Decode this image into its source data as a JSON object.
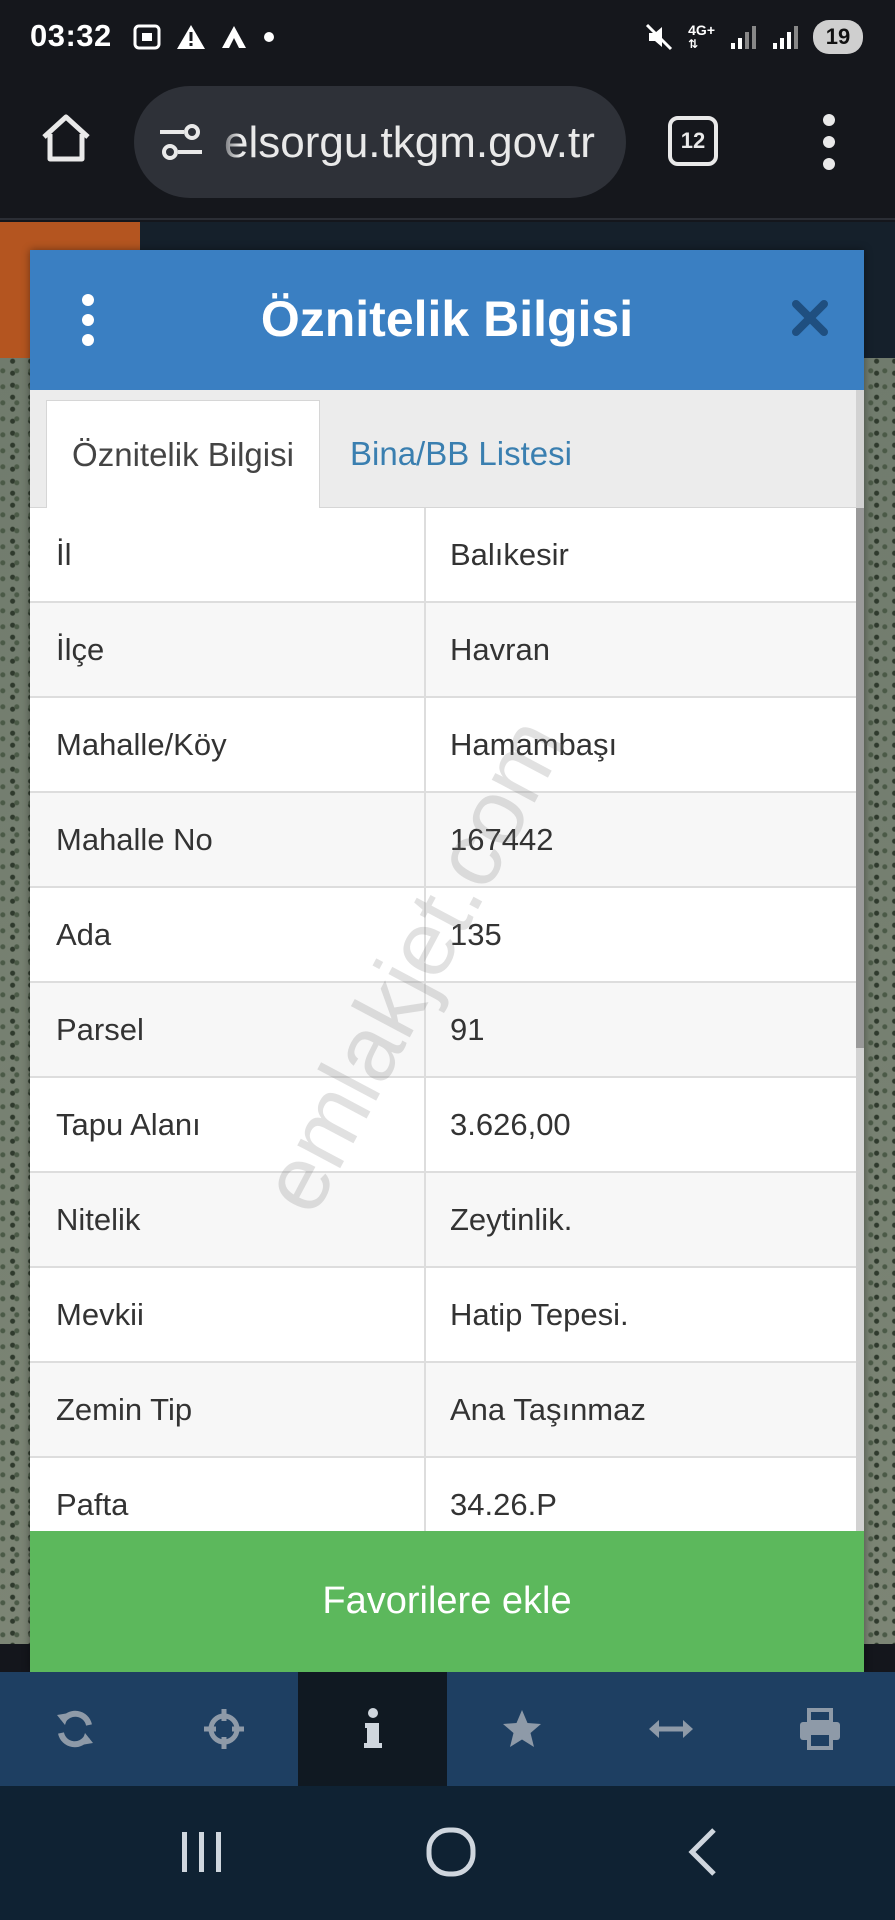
{
  "status_bar": {
    "time": "03:32",
    "left_icons": [
      "screenshot-icon",
      "warning-icon",
      "app-a-icon",
      "dot-icon"
    ],
    "right_icons": [
      "mute-icon",
      "4g-signal-icon",
      "signal-icon",
      "signal-icon"
    ],
    "network": "4G+",
    "battery": "19"
  },
  "browser": {
    "url": "elsorgu.tkgm.gov.tr",
    "tab_count": "12",
    "icons": [
      "home-icon",
      "site-settings-icon",
      "tab-switcher-icon",
      "more-vert-icon"
    ]
  },
  "dialog": {
    "title": "Öznitelik Bilgisi",
    "header_color": "#3a7fc2",
    "tabs": [
      {
        "label": "Öznitelik Bilgisi",
        "active": true
      },
      {
        "label": "Bina/BB Listesi",
        "active": false
      }
    ],
    "rows": [
      {
        "label": "İl",
        "value": "Balıkesir"
      },
      {
        "label": "İlçe",
        "value": "Havran"
      },
      {
        "label": "Mahalle/Köy",
        "value": "Hamambaşı"
      },
      {
        "label": "Mahalle No",
        "value": "167442"
      },
      {
        "label": "Ada",
        "value": "135"
      },
      {
        "label": "Parsel",
        "value": "91"
      },
      {
        "label": "Tapu Alanı",
        "value": "3.626,00"
      },
      {
        "label": "Nitelik",
        "value": "Zeytinlik."
      },
      {
        "label": "Mevkii",
        "value": "Hatip Tepesi."
      },
      {
        "label": "Zemin Tip",
        "value": "Ana Taşınmaz"
      },
      {
        "label": "Pafta",
        "value": "34.26.P"
      }
    ],
    "favorite_button": "Favorilere ekle",
    "favorite_color": "#5cb85c",
    "watermark": "emlakjet.com"
  },
  "toolbar": {
    "items": [
      {
        "icon": "refresh-icon",
        "active": false
      },
      {
        "icon": "crosshair-icon",
        "active": false
      },
      {
        "icon": "info-icon",
        "active": true
      },
      {
        "icon": "star-icon",
        "active": false
      },
      {
        "icon": "measure-icon",
        "active": false
      },
      {
        "icon": "print-icon",
        "active": false
      }
    ]
  },
  "navbar": {
    "icons": [
      "recent-apps-icon",
      "home-circle-icon",
      "back-icon"
    ]
  }
}
